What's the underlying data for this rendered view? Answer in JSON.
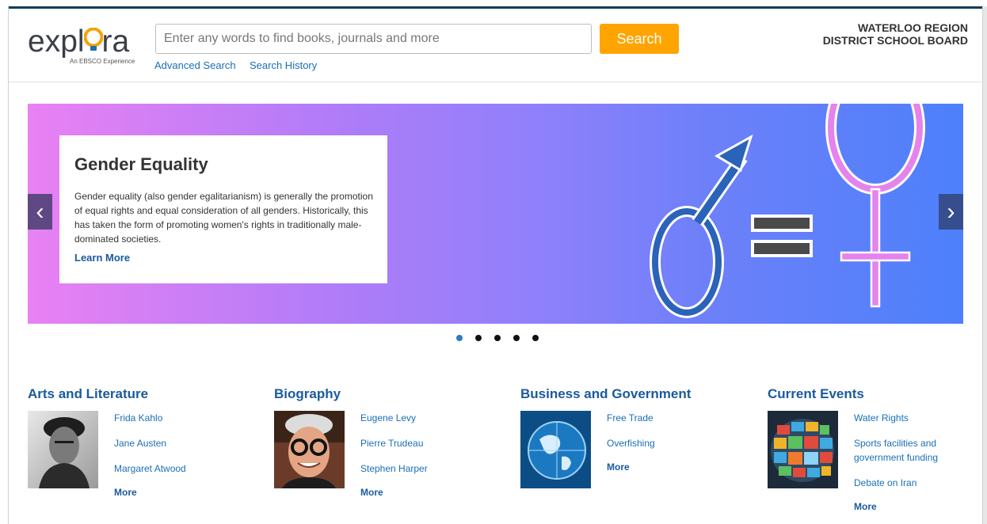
{
  "header": {
    "logo_text_1": "expl",
    "logo_text_2": "ra",
    "logo_sub": "An EBSCO Experience",
    "search_placeholder": "Enter any words to find books, journals and more",
    "search_button": "Search",
    "advanced_search": "Advanced Search",
    "search_history": "Search History",
    "org_name": "WATERLOO REGION DISTRICT SCHOOL BOARD"
  },
  "carousel": {
    "title": "Gender Equality",
    "description": "Gender equality (also gender egalitarianism) is generally the promotion of equal rights and equal consideration of all genders. Historically, this has taken the form of promoting women's rights in traditionally male-dominated societies.",
    "learn_more": "Learn More",
    "prev_arrow": "‹",
    "next_arrow": "›",
    "slide_count": 5,
    "active_slide": 1
  },
  "categories": [
    {
      "title": "Arts and Literature",
      "image_icon": "frida-kahlo-portrait",
      "links": [
        "Frida Kahlo",
        "Jane Austen",
        "Margaret Atwood"
      ],
      "more": "More"
    },
    {
      "title": "Biography",
      "image_icon": "eugene-levy-portrait",
      "links": [
        "Eugene Levy",
        "Pierre Trudeau",
        "Stephen Harper"
      ],
      "more": "More"
    },
    {
      "title": "Business and Government",
      "image_icon": "globe-image",
      "links": [
        "Free Trade",
        "Overfishing"
      ],
      "more": "More"
    },
    {
      "title": "Current Events",
      "image_icon": "screens-globe-image",
      "links": [
        "Water Rights",
        "Sports facilities and government funding",
        "Debate on Iran"
      ],
      "more": "More"
    }
  ],
  "colors": {
    "accent_orange": "#ffa400",
    "link_blue": "#1a6fb5",
    "title_blue": "#1a5a9e",
    "active_dot": "#2d7bc4"
  }
}
